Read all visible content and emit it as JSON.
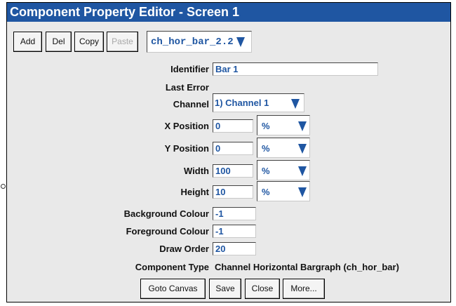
{
  "window": {
    "title": "Component Property Editor - Screen 1"
  },
  "toolbar": {
    "add_label": "Add",
    "del_label": "Del",
    "copy_label": "Copy",
    "paste_label": "Paste",
    "component_select": "ch_hor_bar_2.2"
  },
  "form": {
    "identifier": {
      "label": "Identifier",
      "value": "Bar 1"
    },
    "last_error": {
      "label": "Last Error"
    },
    "channel": {
      "label": "Channel",
      "value": "1) Channel 1"
    },
    "x_position": {
      "label": "X Position",
      "value": "0",
      "unit": "%"
    },
    "y_position": {
      "label": "Y Position",
      "value": "0",
      "unit": "%"
    },
    "width": {
      "label": "Width",
      "value": "100",
      "unit": "%"
    },
    "height": {
      "label": "Height",
      "value": "10",
      "unit": "%"
    },
    "background_colour": {
      "label": "Background Colour",
      "value": "-1"
    },
    "foreground_colour": {
      "label": "Foreground Colour",
      "value": "-1"
    },
    "draw_order": {
      "label": "Draw Order",
      "value": "20"
    },
    "component_type": {
      "label": "Component Type",
      "value": "Channel Horizontal Bargraph (ch_hor_bar)"
    }
  },
  "footer": {
    "goto_canvas_label": "Goto Canvas",
    "save_label": "Save",
    "close_label": "Close",
    "more_label": "More..."
  },
  "colors": {
    "title_bar": "#1f56a2",
    "accent_text": "#1f56a2",
    "panel": "#e9e9e9"
  }
}
